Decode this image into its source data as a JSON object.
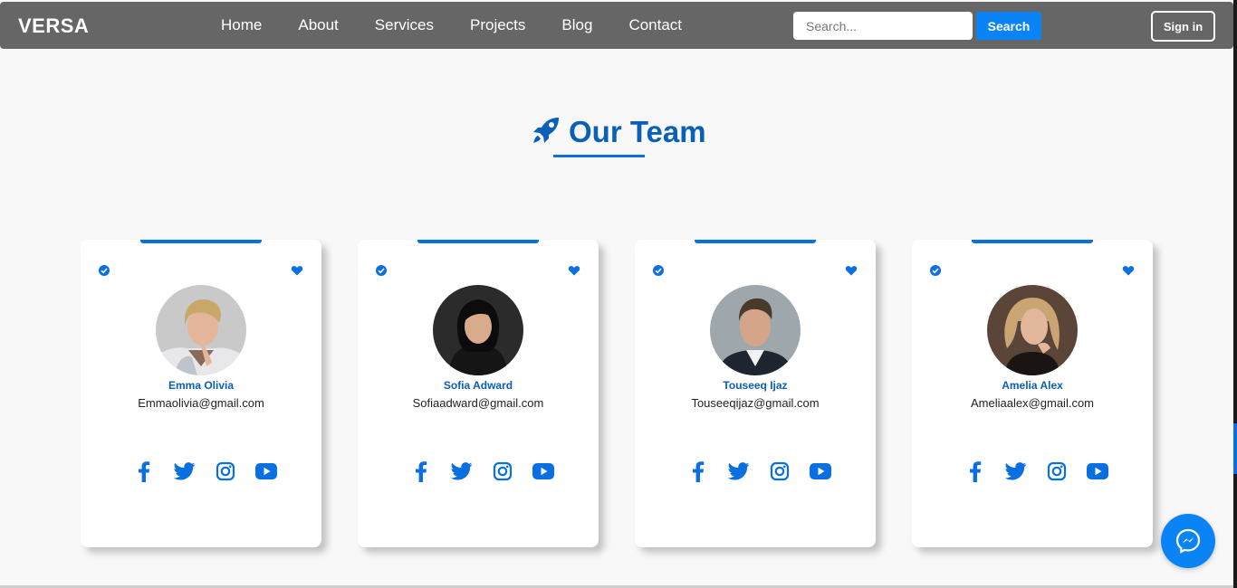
{
  "navbar": {
    "brand": "VERSA",
    "links": [
      "Home",
      "About",
      "Services",
      "Projects",
      "Blog",
      "Contact"
    ],
    "search_placeholder": "Search...",
    "search_button": "Search",
    "signin_button": "Sign in"
  },
  "section": {
    "title": "Our Team",
    "icon": "rocket-icon"
  },
  "team": [
    {
      "name": "Emma Olivia",
      "email": "Emmaolivia@gmail.com"
    },
    {
      "name": "Sofia Adward",
      "email": "Sofiaadward@gmail.com"
    },
    {
      "name": "Touseeq Ijaz",
      "email": "Touseeqijaz@gmail.com"
    },
    {
      "name": "Amelia Alex",
      "email": "Ameliaalex@gmail.com"
    }
  ],
  "card_icons": [
    "verified-check-icon",
    "heart-icon"
  ],
  "social_icons": [
    "facebook-icon",
    "twitter-icon",
    "instagram-icon",
    "youtube-icon"
  ],
  "widgets": {
    "chat": "messenger-icon"
  },
  "colors": {
    "accent": "#0a6fe0",
    "title": "#0a5fb8",
    "navbar": "#666666",
    "background": "#f8f8f8"
  }
}
